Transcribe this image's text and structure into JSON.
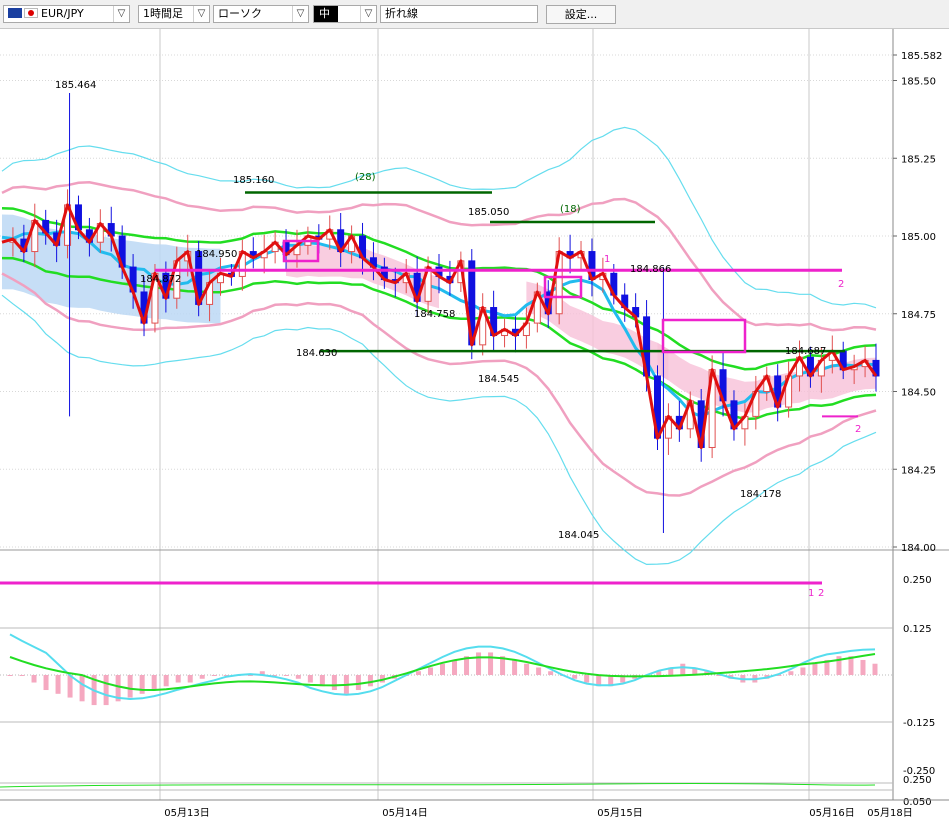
{
  "toolbar": {
    "symbol": "EUR/JPY",
    "timeframe": "1時間足",
    "chart_kind": "ローソク",
    "pane_size": "中",
    "overlay": "折れ線",
    "settings_label": "設定..."
  },
  "colors": {
    "up_candle": "#e05050",
    "down_candle": "#1010e0",
    "price_line": "#e01010",
    "bollinger_outer_pink": "#f0a0c0",
    "bollinger_outer_cyan": "#66ddee",
    "ma_green": "#22dd22",
    "ma_blue": "#22bbee",
    "magenta": "#ee22cc",
    "support_green": "#006600",
    "cloud_blue": "#bcd8f5",
    "cloud_pink": "#f8c0d8"
  },
  "icons": [
    "eu-flag-icon",
    "japan-flag-icon",
    "chevron-down-icon"
  ],
  "chart_data": {
    "type": "line",
    "x_ticks": [
      "05月13日",
      "05月14日",
      "05月15日",
      "05月16日",
      "05月18日"
    ],
    "y_ticks": [
      "185.582",
      "185.50",
      "185.25",
      "185.00",
      "184.75",
      "184.50",
      "184.25",
      "184.00"
    ],
    "ylim": [
      184.0,
      185.582
    ],
    "price_labels": [
      "185.464",
      "185.160",
      "184.950",
      "184.872",
      "184.758",
      "184.630",
      "185.050",
      "184.545",
      "184.866",
      "184.045",
      "184.687",
      "184.178"
    ],
    "annotations": [
      "(28)",
      "(18)",
      "1",
      "2",
      "2",
      "1",
      "2"
    ],
    "series": [
      {
        "name": "",
        "values": [
          184.98,
          184.99,
          184.95,
          185.05,
          185.01,
          184.97,
          185.1,
          185.02,
          184.98,
          185.04,
          185.0,
          184.9,
          184.82,
          184.72,
          184.88,
          184.8,
          184.92,
          184.95,
          184.78,
          184.85,
          184.88,
          184.87,
          184.95,
          184.93,
          184.95,
          184.98,
          184.94,
          184.97,
          185.0,
          184.99,
          185.02,
          184.95,
          185.0,
          184.93,
          184.9,
          184.86,
          184.85,
          184.88,
          184.79,
          184.9,
          184.87,
          184.85,
          184.92,
          184.65,
          184.77,
          184.68,
          184.7,
          184.68,
          184.72,
          184.82,
          184.75,
          184.95,
          184.93,
          184.95,
          184.86,
          184.88,
          184.81,
          184.77,
          184.74,
          184.55,
          184.35,
          184.42,
          184.38,
          184.47,
          184.32,
          184.57,
          184.47,
          184.38,
          184.42,
          184.5,
          184.55,
          184.45,
          184.55,
          184.61,
          184.55,
          184.6,
          184.63,
          184.57,
          184.58,
          184.6,
          184.55
        ]
      }
    ],
    "fib_levels": [
      {
        "label": "185.160",
        "value": 185.14
      },
      {
        "label": "185.050",
        "value": 185.045
      },
      {
        "label": "184.687",
        "value": 184.63
      }
    ],
    "horizontal_lines": [
      {
        "value": 184.89,
        "label": "2"
      }
    ],
    "oscillator": {
      "y_ticks": [
        "0.250",
        "0.125",
        "-0.125",
        "-0.250"
      ],
      "level_label": "1 2",
      "histogram": [
        0,
        0,
        -0.02,
        -0.04,
        -0.05,
        -0.06,
        -0.07,
        -0.08,
        -0.08,
        -0.07,
        -0.06,
        -0.05,
        -0.04,
        -0.03,
        -0.02,
        -0.02,
        -0.01,
        0,
        0,
        0,
        0,
        0.01,
        0,
        0,
        -0.01,
        -0.02,
        -0.03,
        -0.04,
        -0.05,
        -0.04,
        -0.03,
        -0.02,
        -0.01,
        0,
        0.01,
        0.02,
        0.03,
        0.04,
        0.05,
        0.06,
        0.06,
        0.05,
        0.04,
        0.03,
        0.02,
        0.01,
        0,
        -0.01,
        -0.02,
        -0.03,
        -0.03,
        -0.02,
        -0.01,
        0,
        0.01,
        0.02,
        0.03,
        0.02,
        0.01,
        0,
        -0.01,
        -0.02,
        -0.02,
        -0.01,
        0,
        0.01,
        0.02,
        0.03,
        0.04,
        0.05,
        0.05,
        0.04,
        0.03
      ]
    },
    "volume_ticks": [
      "0.250",
      "0.050"
    ]
  }
}
